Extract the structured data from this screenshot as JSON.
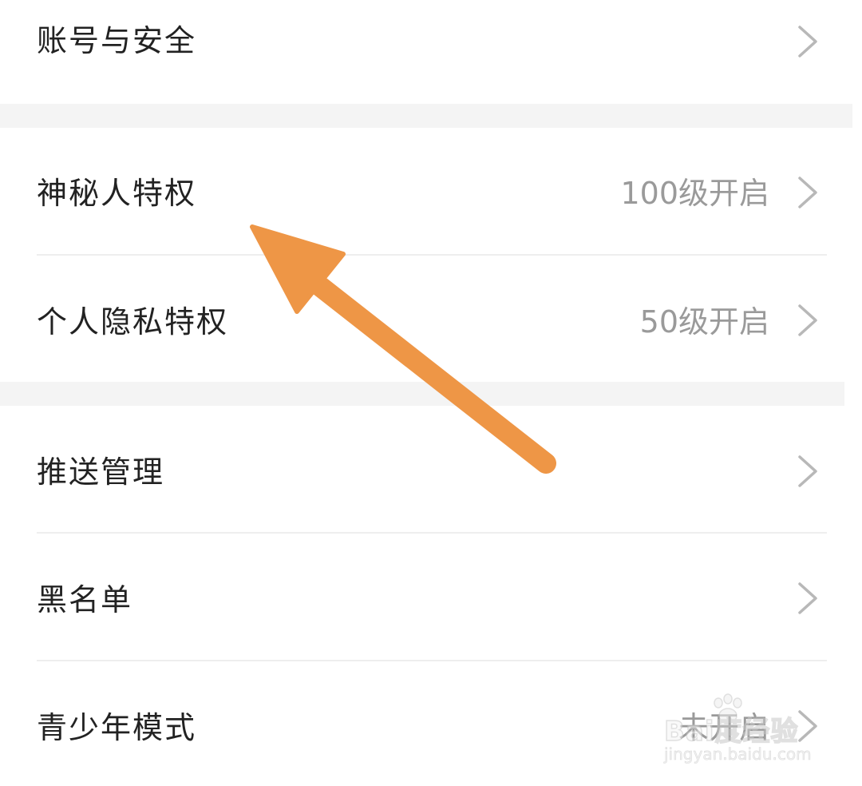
{
  "settings": {
    "items": [
      {
        "label": "账号与安全",
        "value": ""
      },
      {
        "label": "神秘人特权",
        "value": "100级开启"
      },
      {
        "label": "个人隐私特权",
        "value": "50级开启"
      },
      {
        "label": "推送管理",
        "value": ""
      },
      {
        "label": "黑名单",
        "value": ""
      },
      {
        "label": "青少年模式",
        "value": "未开启"
      }
    ]
  },
  "annotation": {
    "arrow_color": "#EE9646"
  },
  "watermark": {
    "brand": "Bai度经验",
    "url": "jingyan.baidu.com"
  },
  "colors": {
    "label": "#222222",
    "value": "#9a9a9a",
    "section_gap": "#f4f4f4",
    "divider": "#eeeeee",
    "chevron": "#b8b8b8"
  }
}
